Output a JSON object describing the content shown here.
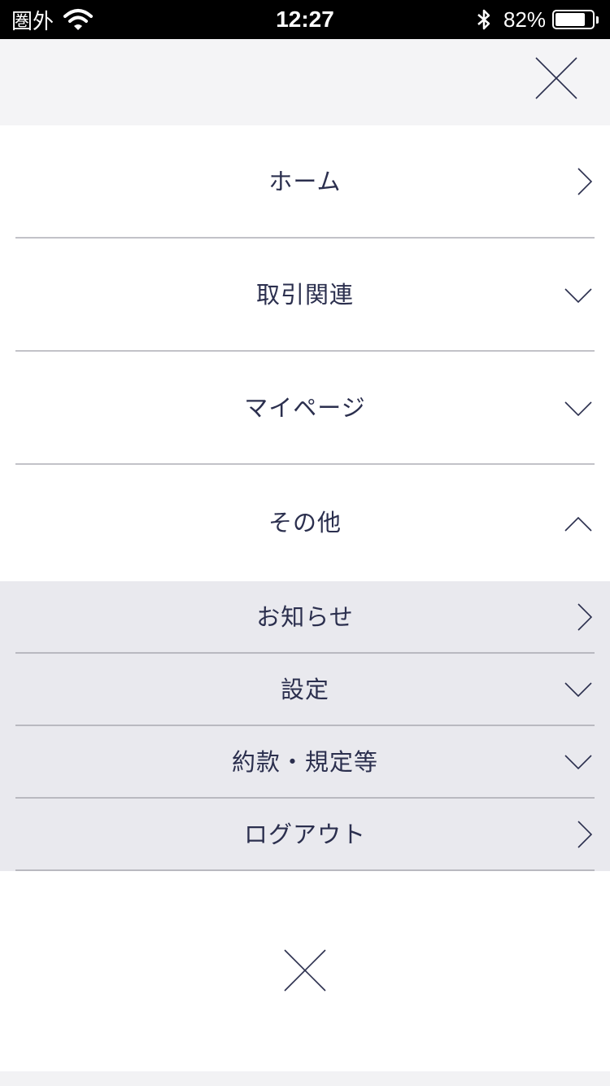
{
  "status_bar": {
    "carrier": "圏外",
    "time": "12:27",
    "battery_percent": "82%",
    "battery_level": 0.82,
    "icons": [
      "wifi-icon",
      "bluetooth-icon",
      "battery-icon"
    ]
  },
  "header": {
    "close_icon": "close-icon"
  },
  "menu": {
    "items": [
      {
        "label": "ホーム",
        "chevron": "chevron-right-icon"
      },
      {
        "label": "取引関連",
        "chevron": "chevron-down-icon"
      },
      {
        "label": "マイページ",
        "chevron": "chevron-down-icon"
      },
      {
        "label": "その他",
        "chevron": "chevron-up-icon"
      }
    ],
    "submenu": [
      {
        "label": "お知らせ",
        "chevron": "chevron-right-icon"
      },
      {
        "label": "設定",
        "chevron": "chevron-down-icon"
      },
      {
        "label": "約款・規定等",
        "chevron": "chevron-down-icon"
      },
      {
        "label": "ログアウト",
        "chevron": "chevron-right-icon"
      }
    ]
  },
  "footer": {
    "close_icon": "close-icon"
  },
  "colors": {
    "text": "#2b2f4e",
    "header_bg": "#f4f4f6",
    "submenu_bg": "#e9e9ee",
    "divider": "#c2c2c8"
  }
}
